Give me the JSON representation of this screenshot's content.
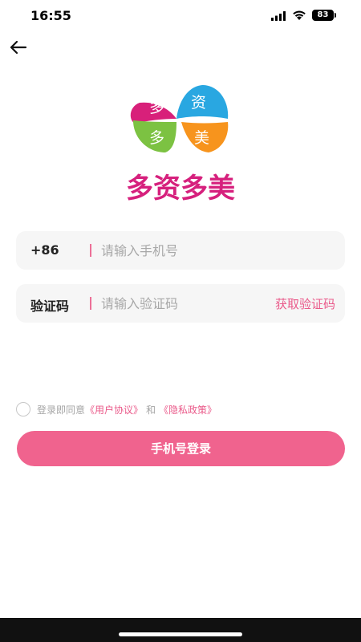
{
  "status_bar": {
    "time": "16:55",
    "battery": "83",
    "icons": [
      "signal-icon",
      "wifi-icon",
      "battery-icon"
    ]
  },
  "header": {
    "back_icon": "arrow-left-icon"
  },
  "logo": {
    "characters": [
      "多",
      "资",
      "多",
      "美"
    ],
    "wordmark": "多资多美",
    "colors": {
      "top_left": "#d8207a",
      "top_right": "#29a7e1",
      "bottom_left": "#7cc242",
      "bottom_right": "#f7941d",
      "wordmark": "#d6207d"
    }
  },
  "phone_field": {
    "prefix": "+86",
    "placeholder": "请输入手机号",
    "value": ""
  },
  "code_field": {
    "label": "验证码",
    "placeholder": "请输入验证码",
    "value": "",
    "get_code_label": "获取验证码"
  },
  "agreement": {
    "prefix": "登录即同意",
    "user_agreement": "《用户协议》",
    "and": "和",
    "privacy_policy": "《隐私政策》",
    "checked": false
  },
  "login_button": {
    "label": "手机号登录"
  },
  "colors": {
    "accent": "#f0638e",
    "link": "#ea5a8a",
    "input_bg": "#f6f6f6"
  }
}
